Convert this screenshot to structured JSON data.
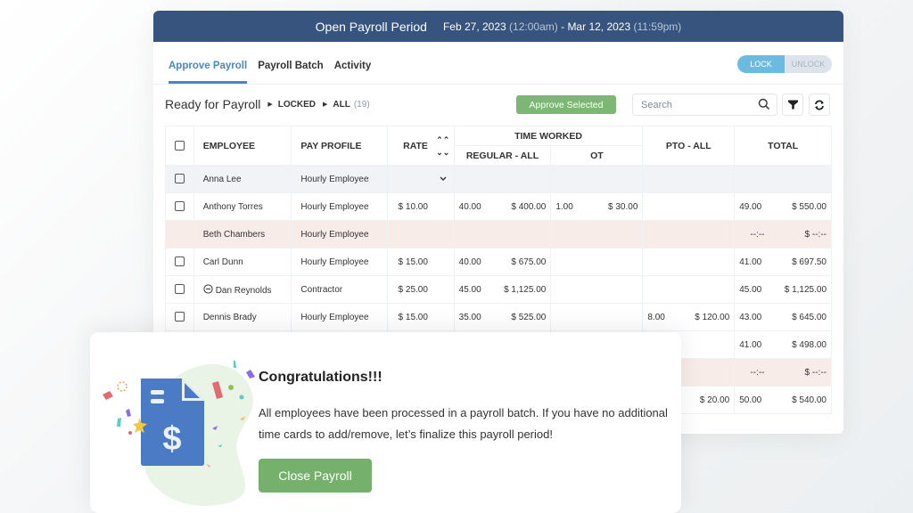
{
  "header": {
    "title": "Open Payroll Period",
    "start_date": "Feb 27, 2023",
    "start_time": "(12:00am)",
    "separator": "-",
    "end_date": "Mar 12, 2023",
    "end_time": "(11:59pm)"
  },
  "tabs": [
    {
      "label": "Approve Payroll",
      "active": true
    },
    {
      "label": "Payroll Batch",
      "active": false
    },
    {
      "label": "Activity",
      "active": false
    }
  ],
  "lock_toggle": {
    "lock_label": "LOCK",
    "unlock_label": "UNLOCK",
    "selected": "LOCK"
  },
  "breadcrumb": {
    "root": "Ready for Payroll",
    "status": "LOCKED",
    "filter": "ALL",
    "count": "(19)"
  },
  "toolbar": {
    "approve_label": "Approve Selected",
    "search_placeholder": "Search",
    "search_icon": "search-icon",
    "filter_icon": "filter-icon",
    "refresh_icon": "refresh-icon"
  },
  "table": {
    "headers": {
      "employee": "EMPLOYEE",
      "pay_profile": "PAY PROFILE",
      "rate": "RATE",
      "time_worked": "TIME WORKED",
      "regular": "REGULAR - ALL",
      "ot": "OT",
      "pto": "PTO - ALL",
      "total": "TOTAL"
    },
    "rows": [
      {
        "name": "Anna Lee",
        "profile": "Hourly Employee",
        "rate": "",
        "reg_hrs": "",
        "reg_amt": "",
        "ot_hrs": "",
        "ot_amt": "",
        "pto_hrs": "",
        "pto_amt": "",
        "total_hrs": "",
        "total_amt": "",
        "style": "grey",
        "checkbox": true,
        "expand": true
      },
      {
        "name": "Anthony Torres",
        "profile": "Hourly Employee",
        "rate": "$ 10.00",
        "reg_hrs": "40.00",
        "reg_amt": "$ 400.00",
        "ot_hrs": "1.00",
        "ot_amt": "$ 30.00",
        "pto_hrs": "",
        "pto_amt": "",
        "total_hrs": "49.00",
        "total_amt": "$ 550.00",
        "style": "",
        "checkbox": true
      },
      {
        "name": "Beth Chambers",
        "profile": "Hourly Employee",
        "rate": "",
        "reg_hrs": "",
        "reg_amt": "",
        "ot_hrs": "",
        "ot_amt": "",
        "pto_hrs": "",
        "pto_amt": "",
        "total_hrs": "--:--",
        "total_amt": "$ --:--",
        "style": "pink",
        "checkbox": false
      },
      {
        "name": "Carl Dunn",
        "profile": "Hourly Employee",
        "rate": "$ 15.00",
        "reg_hrs": "40.00",
        "reg_amt": "$ 675.00",
        "ot_hrs": "",
        "ot_amt": "",
        "pto_hrs": "",
        "pto_amt": "",
        "total_hrs": "41.00",
        "total_amt": "$ 697.50",
        "style": "",
        "checkbox": true
      },
      {
        "name": "Dan Reynolds",
        "profile": "Contractor",
        "rate": "$ 25.00",
        "reg_hrs": "45.00",
        "reg_amt": "$ 1,125.00",
        "ot_hrs": "",
        "ot_amt": "",
        "pto_hrs": "",
        "pto_amt": "",
        "total_hrs": "45.00",
        "total_amt": "$ 1,125.00",
        "style": "",
        "checkbox": true,
        "minus_icon": true
      },
      {
        "name": "Dennis Brady",
        "profile": "Hourly Employee",
        "rate": "$ 15.00",
        "reg_hrs": "35.00",
        "reg_amt": "$ 525.00",
        "ot_hrs": "",
        "ot_amt": "",
        "pto_hrs": "8.00",
        "pto_amt": "$ 120.00",
        "total_hrs": "43.00",
        "total_amt": "$ 645.00",
        "style": "",
        "checkbox": true
      },
      {
        "name": "",
        "profile": "",
        "rate": "",
        "reg_hrs": "",
        "reg_amt": "",
        "ot_hrs": "",
        "ot_amt": "",
        "pto_hrs": "",
        "pto_amt": "",
        "total_hrs": "41.00",
        "total_amt": "$ 498.00",
        "style": "",
        "checkbox": false
      },
      {
        "name": "",
        "profile": "",
        "rate": "",
        "reg_hrs": "",
        "reg_amt": "",
        "ot_hrs": "",
        "ot_amt": "",
        "pto_hrs": "",
        "pto_amt": "",
        "total_hrs": "--:--",
        "total_amt": "$ --:--",
        "style": "pink",
        "checkbox": false
      },
      {
        "name": "",
        "profile": "",
        "rate": "",
        "reg_hrs": "",
        "reg_amt": "",
        "ot_hrs": "",
        "ot_amt": "",
        "pto_hrs": "",
        "pto_amt": "$ 20.00",
        "total_hrs": "50.00",
        "total_amt": "$ 540.00",
        "style": "",
        "checkbox": false
      }
    ]
  },
  "modal": {
    "title": "Congratulations!!!",
    "message": "All employees have been processed in a payroll batch. If you have no additional time cards to add/remove, let’s finalize this payroll period!",
    "button_label": "Close Payroll",
    "illustration_icon": "payroll-document-icon"
  },
  "colors": {
    "header_bg": "#36547e",
    "accent_blue": "#4a86c5",
    "approve_green": "#7cb874",
    "close_green": "#76b06d",
    "lock_active": "#6bbbe0",
    "row_pink": "#f8ece9",
    "row_grey": "#f1f3f6"
  }
}
